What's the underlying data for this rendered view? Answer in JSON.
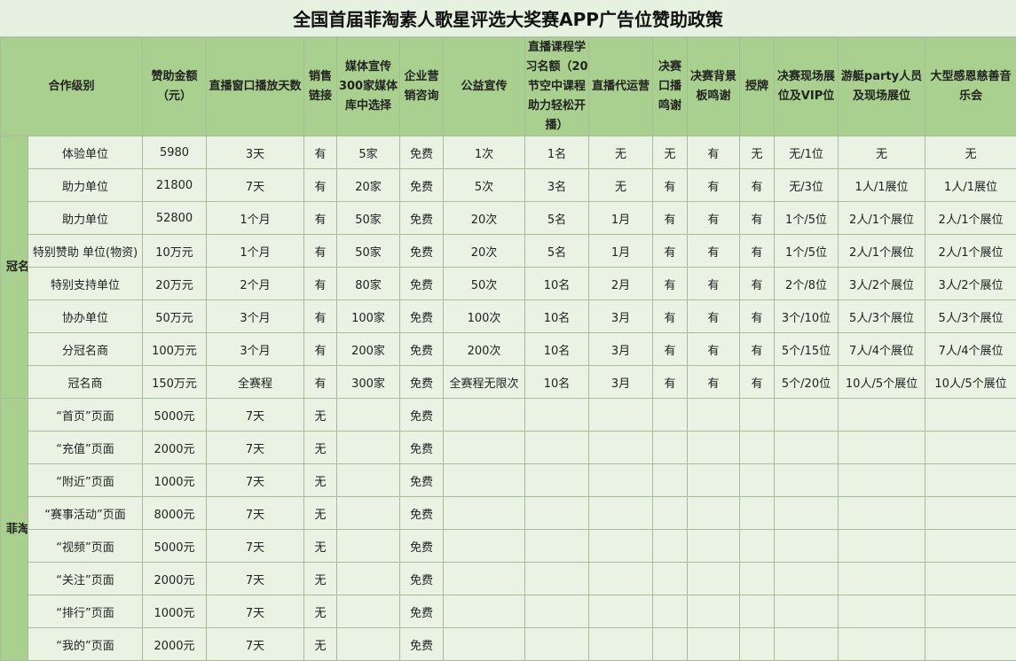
{
  "title": "全国首届菲淘素人歌星评选大奖赛APP广告位赞助政策",
  "headers": [
    "合作级别",
    "赞助金额（元）",
    "直播窗口播放天数",
    "销售链接",
    "媒体宣传300家媒体库中选择",
    "企业营销咨询",
    "公益宣传",
    "直播课程学习名额（20节空中课程助力轻松开播）",
    "直播代运营",
    "决赛口播鸣谢",
    "决赛背景板鸣谢",
    "授牌",
    "决赛现场展位及VIP位",
    "游艇party人员及现场展位",
    "大型感恩慈善音乐会"
  ],
  "groups": {
    "sponsor": "冠名及赞助单位",
    "app": "菲淘直播APP广告位"
  },
  "sponsor_rows": [
    [
      "体验单位",
      "5980",
      "3天",
      "有",
      "5家",
      "免费",
      "1次",
      "1名",
      "无",
      "无",
      "有",
      "无",
      "无/1位",
      "无",
      "无"
    ],
    [
      "助力单位",
      "21800",
      "7天",
      "有",
      "20家",
      "免费",
      "5次",
      "3名",
      "无",
      "有",
      "有",
      "有",
      "无/3位",
      "1人/1展位",
      "1人/1展位"
    ],
    [
      "助力单位",
      "52800",
      "1个月",
      "有",
      "50家",
      "免费",
      "20次",
      "5名",
      "1月",
      "有",
      "有",
      "有",
      "1个/5位",
      "2人/1个展位",
      "2人/1个展位"
    ],
    [
      "特别赞助 单位(物资)",
      "10万元",
      "1个月",
      "有",
      "50家",
      "免费",
      "20次",
      "5名",
      "1月",
      "有",
      "有",
      "有",
      "1个/5位",
      "2人/1个展位",
      "2人/1个展位"
    ],
    [
      "特别支持单位",
      "20万元",
      "2个月",
      "有",
      "80家",
      "免费",
      "50次",
      "10名",
      "2月",
      "有",
      "有",
      "有",
      "2个/8位",
      "3人/2个展位",
      "3人/2个展位"
    ],
    [
      "协办单位",
      "50万元",
      "3个月",
      "有",
      "100家",
      "免费",
      "100次",
      "10名",
      "3月",
      "有",
      "有",
      "有",
      "3个/10位",
      "5人/3个展位",
      "5人/3个展位"
    ],
    [
      "分冠名商",
      "100万元",
      "3个月",
      "有",
      "200家",
      "免费",
      "200次",
      "10名",
      "3月",
      "有",
      "有",
      "有",
      "5个/15位",
      "7人/4个展位",
      "7人/4个展位"
    ],
    [
      "冠名商",
      "150万元",
      "全赛程",
      "有",
      "300家",
      "免费",
      "全赛程无限次",
      "10名",
      "3月",
      "有",
      "有",
      "有",
      "5个/20位",
      "10人/5个展位",
      "10人/5个展位"
    ]
  ],
  "app_rows": [
    [
      "“首页”页面",
      "5000元",
      "7天",
      "无",
      "",
      "免费"
    ],
    [
      "“充值”页面",
      "2000元",
      "7天",
      "无",
      "",
      "免费"
    ],
    [
      "“附近”页面",
      "1000元",
      "7天",
      "无",
      "",
      "免费"
    ],
    [
      "“赛事活动”页面",
      "8000元",
      "7天",
      "无",
      "",
      "免费"
    ],
    [
      "“视频”页面",
      "5000元",
      "7天",
      "无",
      "",
      "免费"
    ],
    [
      "“关注”页面",
      "2000元",
      "7天",
      "无",
      "",
      "免费"
    ],
    [
      "“排行”页面",
      "1000元",
      "7天",
      "无",
      "",
      "免费"
    ],
    [
      "“我的”页面",
      "2000元",
      "7天",
      "无",
      "",
      "免费"
    ]
  ],
  "colors": {
    "header_bg": "#a9d08e",
    "cell_bg": "#e9f2e3",
    "highlight_text": "#e60000",
    "border": "#a9bb9d"
  }
}
